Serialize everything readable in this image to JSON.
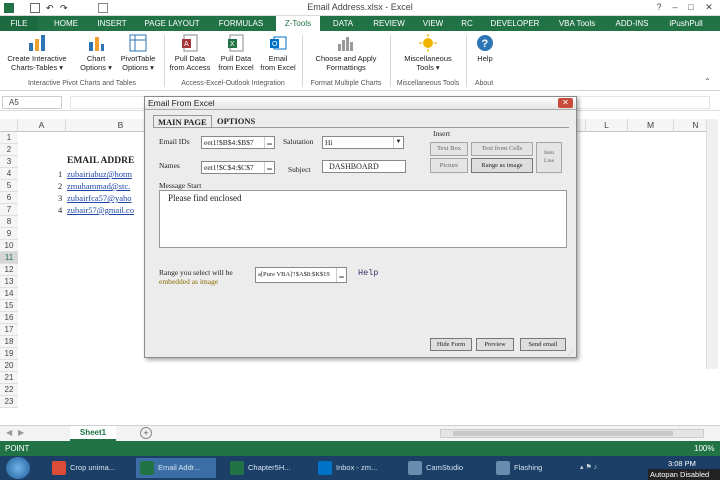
{
  "window": {
    "title": "Email Address.xlsx - Excel",
    "controls": [
      "?",
      "–",
      "□",
      "✕"
    ]
  },
  "ribbon_tabs": [
    "FILE",
    "HOME",
    "INSERT",
    "PAGE LAYOUT",
    "FORMULAS",
    "Z-Tools",
    "DATA",
    "REVIEW",
    "VIEW",
    "RC",
    "DEVELOPER",
    "VBA Tools",
    "ADD-INS",
    "iPushPull"
  ],
  "active_tab": "Z-Tools",
  "ribbon": {
    "buttons": [
      {
        "label1": "Create Interactive",
        "label2": "Charts-Tables ▾",
        "icon": "interactive-chart-icon",
        "color": "#2e75b6"
      },
      {
        "label1": "Chart",
        "label2": "Options ▾",
        "icon": "chart-icon",
        "color": "#2e75b6"
      },
      {
        "label1": "PivotTable",
        "label2": "Options ▾",
        "icon": "pivot-table-icon",
        "color": "#2e75b6"
      },
      {
        "label1": "Pull Data",
        "label2": "from Access",
        "icon": "access-icon",
        "color": "#a4373a"
      },
      {
        "label1": "Pull Data",
        "label2": "from Excel",
        "icon": "excel-icon",
        "color": "#217346"
      },
      {
        "label1": "Email",
        "label2": "from Excel",
        "icon": "outlook-email-icon",
        "color": "#0072c6"
      },
      {
        "label1": "Choose and Apply",
        "label2": "Formattings",
        "icon": "format-icon",
        "color": "#888888"
      },
      {
        "label1": "Miscellaneous",
        "label2": "Tools ▾",
        "icon": "sun-tools-icon",
        "color": "#f0b400"
      },
      {
        "label1": "Help",
        "label2": "",
        "icon": "help-icon",
        "color": "#2e75b6"
      }
    ],
    "groups": [
      "Interactive Pivot Charts and Tables",
      "Access-Excel-Outlook Integration",
      "Format Multiple Charts",
      "Miscellaneous Tools",
      "About"
    ]
  },
  "formula_bar": {
    "name_box": "A5",
    "content": ""
  },
  "grid": {
    "columns": [
      "A",
      "B",
      "L",
      "M",
      "N"
    ],
    "rows": [
      "1",
      "2",
      "3",
      "4",
      "5",
      "6",
      "7",
      "8",
      "9",
      "10",
      "11",
      "12",
      "13",
      "14",
      "15",
      "16",
      "17",
      "18",
      "19",
      "20",
      "21",
      "22",
      "23"
    ],
    "selected_row": "11",
    "heading": "EMAIL ADDRE",
    "entries": [
      {
        "n": "1",
        "email": "zubairiabuz@hotm"
      },
      {
        "n": "2",
        "email": "zmuhammad@stc."
      },
      {
        "n": "3",
        "email": "zubairfca57@yaho"
      },
      {
        "n": "4",
        "email": "zubair57@gmail.co"
      }
    ]
  },
  "sheet_tabs": [
    "Sheet1"
  ],
  "status_bar": {
    "left": "POINT",
    "zoom": "100%"
  },
  "taskbar": {
    "items": [
      {
        "label": "Crop unima...",
        "icon": "chrome-icon",
        "color": "#dd4b39"
      },
      {
        "label": "Email Addr...",
        "icon": "excel-icon",
        "color": "#217346"
      },
      {
        "label": "Chapter5H...",
        "icon": "excel-icon",
        "color": "#217346"
      },
      {
        "label": "Inbox - zm...",
        "icon": "outlook-icon",
        "color": "#0072c6"
      },
      {
        "label": "CamStudio",
        "icon": "camstudio-icon",
        "color": "#6a8caf"
      },
      {
        "label": "Flashing",
        "icon": "flashing-icon",
        "color": "#6a8caf"
      }
    ],
    "clock": "3:08 PM",
    "overlay_text": "Autopan Disabled"
  },
  "dialog": {
    "title": "Email From Excel",
    "close": "✕",
    "tabs": [
      "MAIN PAGE",
      "OPTIONS"
    ],
    "email_ids_label": "Email IDs",
    "email_ids_value": "eet1!$B$4:$B$7",
    "salutation_label": "Salutation",
    "salutation_value": "Hi",
    "names_label": "Names",
    "names_value": "eet1!$C$4:$C$7",
    "subject_label": "Subject",
    "subject_value": "DASHBOARD",
    "insert_label": "Insert",
    "insert_buttons": {
      "text_box": "Text Box",
      "text_from_cells": "Text from Cells",
      "picture": "Picture",
      "range_as_image": "Range as image",
      "item": "Item",
      "line": "Line"
    },
    "message_label": "Message Start",
    "message_value": "Please find enclosed",
    "range_label1": "Range you select will be",
    "range_label2": "embedded as image",
    "range_value": "a[Pure VBA]'!$A$8:$K$19",
    "help": "Help",
    "buttons": {
      "hide_form": "Hide Form",
      "preview": "Preview",
      "send_email": "Send email"
    }
  }
}
